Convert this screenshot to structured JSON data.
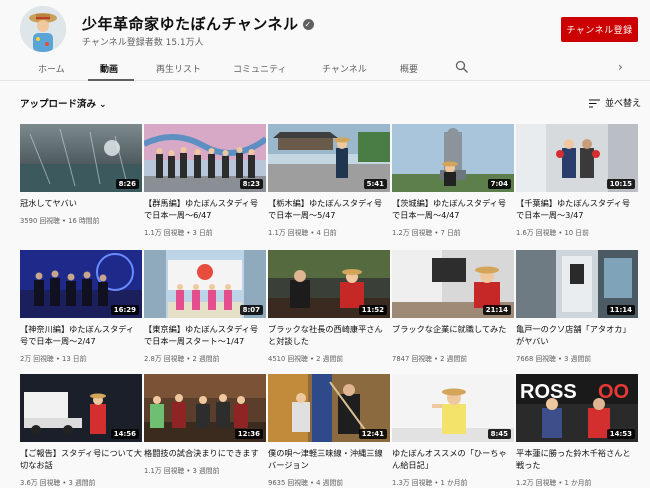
{
  "channel": {
    "name": "少年革命家ゆたぼんチャンネル",
    "subscribers": "チャンネル登録者数 15.1万人",
    "subscribe_label": "チャンネル登録"
  },
  "tabs": [
    "ホーム",
    "動画",
    "再生リスト",
    "コミュニティ",
    "チャンネル",
    "概要"
  ],
  "filter_label": "アップロード済み",
  "sort_label": "並べ替え",
  "icons": {
    "verified": "check-badge-icon",
    "search": "search-icon",
    "next": "chevron-right-icon",
    "sort": "sort-icon",
    "filter": "chevron-down-icon"
  },
  "colors": {
    "subscribe": "#cc0000",
    "duration_bg": "#000000"
  },
  "videos": [
    {
      "title": "冠水してヤバい",
      "meta": "3590 回視聴 • 16 時間前",
      "duration": "8:26"
    },
    {
      "title": "【群馬編】ゆたぼんスタディ号で日本一周〜6/47",
      "meta": "1.1万 回視聴 • 3 日前",
      "duration": "8:23"
    },
    {
      "title": "【栃木編】ゆたぼんスタディ号で日本一周〜5/47",
      "meta": "1.1万 回視聴 • 4 日前",
      "duration": "5:41"
    },
    {
      "title": "【茨城編】ゆたぼんスタディ号で日本一周〜4/47",
      "meta": "1.2万 回視聴 • 7 日前",
      "duration": "7:04"
    },
    {
      "title": "【千葉編】ゆたぼんスタディ号で日本一周〜3/47",
      "meta": "1.6万 回視聴 • 10 日前",
      "duration": "10:15"
    },
    {
      "title": "【神奈川編】ゆたぼんスタディ号で日本一周〜2/47",
      "meta": "2万 回視聴 • 13 日前",
      "duration": "16:29"
    },
    {
      "title": "【東京編】ゆたぼんスタディ号で日本一周スタート〜1/47",
      "meta": "2.8万 回視聴 • 2 週間前",
      "duration": "8:07"
    },
    {
      "title": "ブラックな社長の西崎康平さんと対談した",
      "meta": "4510 回視聴 • 2 週間前",
      "duration": "11:52"
    },
    {
      "title": "ブラックな企業に就職してみた",
      "meta": "7847 回視聴 • 2 週間前",
      "duration": "21:14"
    },
    {
      "title": "亀戸一のクソ店舗「アタオカ」がヤバい",
      "meta": "7668 回視聴 • 3 週間前",
      "duration": "11:14"
    },
    {
      "title": "【ご報告】スタディ号について大切なお話",
      "meta": "3.6万 回視聴 • 3 週間前",
      "duration": "14:56"
    },
    {
      "title": "格闘技の試合決まりにできます",
      "meta": "1.1万 回視聴 • 3 週間前",
      "duration": "12:36"
    },
    {
      "title": "僕の唄〜津軽三味線・沖縄三線バージョン",
      "meta": "9635 回視聴 • 4 週間前",
      "duration": "12:41"
    },
    {
      "title": "ゆたぼんオススメの「ひーちゃん給日記」",
      "meta": "1.3万 回視聴 • 1 か月前",
      "duration": "8:45"
    },
    {
      "title": "平本蓮に勝った鈴木千裕さんと戦った",
      "meta": "1.2万 回視聴 • 1 か月前",
      "duration": "14:53"
    }
  ]
}
